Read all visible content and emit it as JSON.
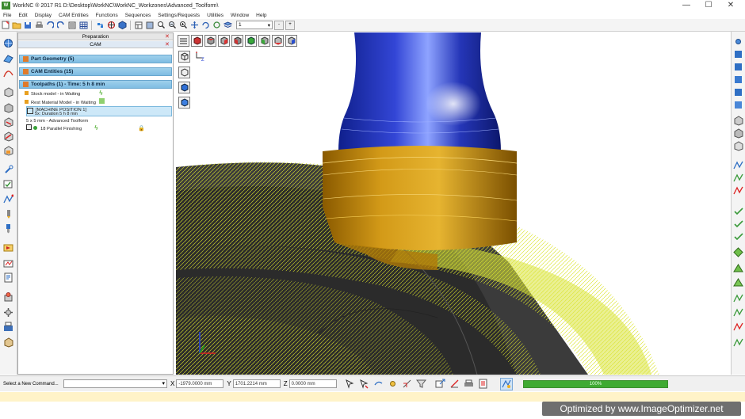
{
  "window": {
    "title": "WorkNC ® 2017 R1 D:\\Desktop\\WorkNC\\WorkNC_Workzones\\Advanced_Toolform\\",
    "app_icon_text": "W",
    "controls": {
      "minimize": "—",
      "maximize": "☐",
      "close": "✕"
    }
  },
  "menu": [
    "File",
    "Edit",
    "Display",
    "CAM Entities",
    "Functions",
    "Sequences",
    "Settings/Requests",
    "Utilities",
    "Window",
    "Help"
  ],
  "toolbar": {
    "layer_value": "1",
    "minus_label": "-",
    "plus_label": "+"
  },
  "panel": {
    "tab_preparation": "Preparation",
    "tab_cam": "CAM",
    "sections": [
      {
        "label": "Part Geometry (5)"
      },
      {
        "label": "CAM Entities (15)"
      },
      {
        "label": "Toolpaths (1) - Time: 5 h 8 min"
      }
    ],
    "tree": [
      {
        "label": "Stock model - in Waiting"
      },
      {
        "label": "Rest Material Model - in Waiting"
      },
      {
        "label": "[MACHINE POSITION 1]"
      },
      {
        "label": "5x: Duration 5 h 8 min"
      },
      {
        "label": "5 x 5 mm  - Advanced Toolform"
      },
      {
        "label": "18   Parallel Finishing"
      }
    ]
  },
  "statusbar": {
    "command_label": "Select a New Command...",
    "command_value": "",
    "x_label": "X",
    "x_value": "-1979.0000 mm",
    "y_label": "Y",
    "y_value": "1701.2214 mm",
    "z_label": "Z",
    "z_value": "0.0000 mm",
    "progress_percent": 100,
    "progress_text": "100%"
  },
  "watermark": "Optimized by www.ImageOptimizer.net",
  "colors": {
    "tool_holder": "#2b3fb8",
    "tool_collar": "#c98d10",
    "toolpath": "#e6ee3a",
    "section_header": "#8fc7e8",
    "progress": "#5fb84d"
  }
}
